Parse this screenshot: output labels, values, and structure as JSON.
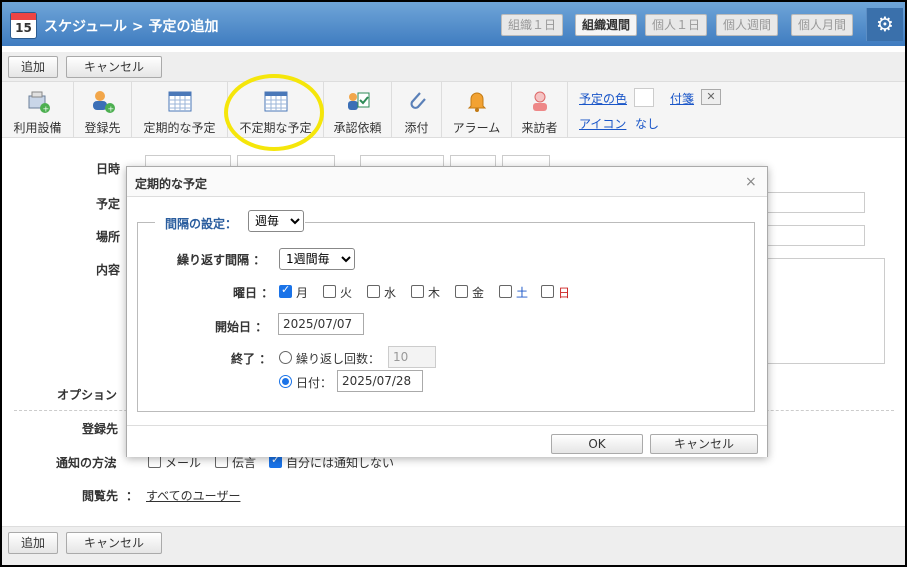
{
  "header": {
    "calendar_day": "15",
    "title": "スケジュール > 予定の追加",
    "views": [
      "組織１日",
      "組織週間",
      "個人１日",
      "個人週間",
      "個人月間"
    ],
    "active_view": "組織週間"
  },
  "actions": {
    "add": "追加",
    "cancel": "キャンセル"
  },
  "toolbar": {
    "items": [
      "利用設備",
      "登録先",
      "定期的な予定",
      "不定期な予定",
      "承認依頼",
      "添付",
      "アラーム",
      "来訪者"
    ],
    "color_label": "予定の色",
    "sticky_label": "付箋",
    "icon_label": "アイコン",
    "icon_value": "なし"
  },
  "form": {
    "datetime": "日時",
    "schedule": "予定",
    "place": "場所",
    "content": "内容",
    "option": "オプション",
    "registrant": "登録先",
    "notify_label": "通知の方法",
    "notify_mail": "メール",
    "notify_memo": "伝言",
    "notify_self": "自分には通知しない",
    "viewer_label": "閲覧先",
    "viewer_value": "すべてのユーザー"
  },
  "dialog": {
    "title": "定期的な予定",
    "close": "×",
    "interval_setting_label": "間隔の設定",
    "interval_type": "週毎",
    "repeat_interval_label": "繰り返す間隔",
    "repeat_interval_value": "1週間毎",
    "weekday_label": "曜日",
    "weekdays": [
      {
        "label": "月",
        "checked": true,
        "color": "#333333"
      },
      {
        "label": "火",
        "checked": false,
        "color": "#333333"
      },
      {
        "label": "水",
        "checked": false,
        "color": "#333333"
      },
      {
        "label": "木",
        "checked": false,
        "color": "#333333"
      },
      {
        "label": "金",
        "checked": false,
        "color": "#333333"
      },
      {
        "label": "土",
        "checked": false,
        "color": "#1a56c8"
      },
      {
        "label": "日",
        "checked": false,
        "color": "#cc2222"
      }
    ],
    "start_label": "開始日",
    "start_value": "2025/07/07",
    "end_label": "終了",
    "end_count_label": "繰り返し回数",
    "end_count_value": "10",
    "end_date_label": "日付",
    "end_date_value": "2025/07/28",
    "ok": "OK",
    "cancel": "キャンセル"
  }
}
